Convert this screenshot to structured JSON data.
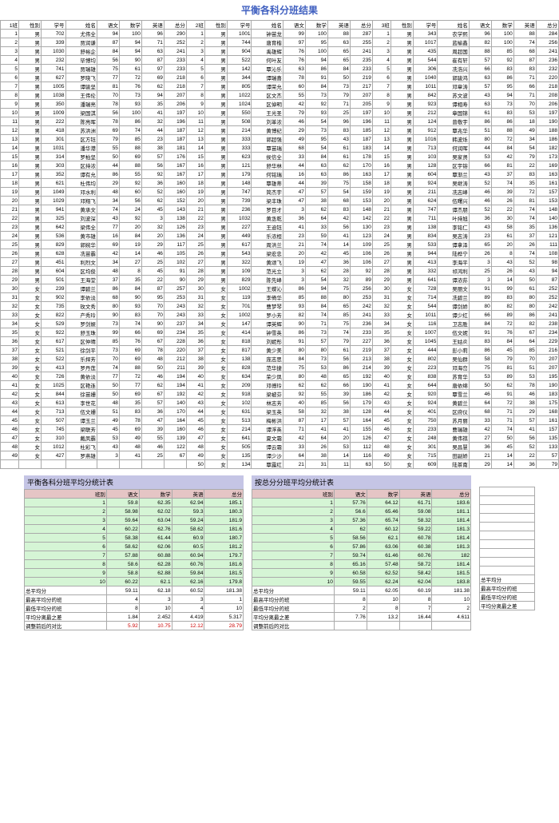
{
  "title": "平衡各科分班结果",
  "headers": [
    "班",
    "性别",
    "学号",
    "姓名",
    "语文",
    "数学",
    "英语",
    "总分"
  ],
  "class_labels": [
    "1班",
    "2班",
    "3班"
  ],
  "rows": [
    [
      1,
      "男",
      702,
      "尤伟全",
      94,
      100,
      96,
      290,
      1,
      "男",
      1001,
      "钟苗龙",
      99,
      100,
      88,
      287,
      1,
      "男",
      343,
      "农学熙",
      96,
      100,
      88,
      284
    ],
    [
      2,
      "男",
      339,
      "贾润谦",
      87,
      94,
      71,
      252,
      2,
      "男",
      744,
      "唐育楷",
      97,
      95,
      63,
      255,
      2,
      "男",
      1017,
      "蓝榆鑫",
      82,
      100,
      74,
      256
    ],
    [
      3,
      "男",
      1030,
      "舒裕企",
      84,
      94,
      63,
      241,
      3,
      "男",
      904,
      "禹雄辉",
      76,
      100,
      65,
      241,
      3,
      "男",
      435,
      "周超国",
      88,
      85,
      68,
      241
    ],
    [
      4,
      "男",
      232,
      "毕博均",
      56,
      90,
      87,
      233,
      4,
      "男",
      522,
      "何叶友",
      76,
      94,
      65,
      235,
      4,
      "男",
      544,
      "崔有轩",
      57,
      92,
      87,
      236
    ],
    [
      5,
      "男",
      741,
      "贾瑞雄",
      75,
      61,
      97,
      233,
      5,
      "男",
      142,
      "覃沁乐",
      63,
      86,
      84,
      233,
      5,
      "男",
      306,
      "冼浩兴",
      66,
      83,
      83,
      232
    ],
    [
      6,
      "男",
      627,
      "罗晓飞",
      77,
      72,
      69,
      218,
      6,
      "男",
      344,
      "谭瑞喜",
      78,
      91,
      50,
      219,
      6,
      "男",
      1040,
      "郭骏鸿",
      63,
      86,
      71,
      220
    ],
    [
      7,
      "男",
      1005,
      "谭骏坚",
      81,
      76,
      62,
      218,
      7,
      "男",
      805,
      "谭荣允",
      60,
      84,
      73,
      217,
      7,
      "男",
      1011,
      "邓章涛",
      57,
      95,
      66,
      218
    ],
    [
      8,
      "男",
      1038,
      "王伟伦",
      70,
      73,
      94,
      207,
      8,
      "男",
      1022,
      "区文杰",
      55,
      73,
      79,
      207,
      8,
      "男",
      842,
      "苏文波",
      43,
      94,
      71,
      208
    ],
    [
      9,
      "男",
      350,
      "潘瑞亮",
      78,
      93,
      35,
      206,
      9,
      "男",
      1024,
      "区倬明",
      42,
      92,
      71,
      205,
      9,
      "男",
      923,
      "谭相寿",
      63,
      73,
      70,
      206
    ],
    [
      10,
      "男",
      1009,
      "梁国淇",
      56,
      100,
      41,
      197,
      10,
      "男",
      550,
      "王光圣",
      79,
      93,
      25,
      197,
      10,
      "男",
      212,
      "章国锦",
      61,
      83,
      53,
      197
    ],
    [
      11,
      "男",
      222,
      "陈亮晖",
      78,
      86,
      32,
      196,
      11,
      "男",
      508,
      "刘革浓",
      46,
      54,
      96,
      196,
      11,
      "男",
      124,
      "曾敬宇",
      86,
      86,
      18,
      190
    ],
    [
      12,
      "男",
      418,
      "苏洪洲",
      69,
      74,
      44,
      187,
      12,
      "男",
      214,
      "黄博纪",
      29,
      73,
      83,
      185,
      12,
      "男",
      912,
      "覃兆华",
      51,
      88,
      49,
      188
    ],
    [
      13,
      "男",
      301,
      "区方钰",
      79,
      85,
      23,
      187,
      13,
      "男",
      333,
      "郭超强",
      49,
      95,
      43,
      187,
      13,
      "男",
      1016,
      "韩波烁",
      80,
      72,
      34,
      186
    ],
    [
      14,
      "男",
      1031,
      "潘华港",
      55,
      88,
      38,
      181,
      14,
      "男",
      333,
      "覃苗瑞",
      68,
      54,
      61,
      183,
      14,
      "男",
      713,
      "何润晖",
      44,
      84,
      54,
      182
    ],
    [
      15,
      "男",
      314,
      "罗柏坚",
      50,
      69,
      57,
      176,
      15,
      "男",
      623,
      "侯信全",
      33,
      84,
      61,
      178,
      15,
      "男",
      103,
      "吴家贤",
      53,
      42,
      79,
      173
    ],
    [
      16,
      "男",
      303,
      "区持浓",
      44,
      88,
      56,
      167,
      16,
      "男",
      121,
      "舒华林",
      44,
      63,
      62,
      170,
      16,
      "男",
      128,
      "区宇镕",
      66,
      81,
      22,
      169
    ],
    [
      17,
      "男",
      352,
      "谭有允",
      86,
      55,
      92,
      167,
      17,
      "男",
      179,
      "何铭瑞",
      16,
      63,
      86,
      163,
      17,
      "男",
      604,
      "覃渐兰",
      43,
      37,
      83,
      163
    ],
    [
      18,
      "男",
      621,
      "杜伟均",
      29,
      92,
      36,
      160,
      18,
      "男",
      148,
      "覃雄蒂",
      44,
      39,
      75,
      158,
      18,
      "男",
      924,
      "吴继涛",
      52,
      74,
      35,
      161
    ],
    [
      19,
      "男",
      1049,
      "邓水利",
      48,
      60,
      52,
      160,
      19,
      "男",
      747,
      "简杰宇",
      47,
      57,
      54,
      159,
      19,
      "男",
      211,
      "冼志峰",
      46,
      39,
      72,
      157
    ],
    [
      20,
      "男",
      1029,
      "邓翔飞",
      34,
      56,
      62,
      152,
      20,
      "男",
      739,
      "梁丰珠",
      47,
      38,
      68,
      153,
      20,
      "男",
      624,
      "伍曙兴",
      46,
      26,
      81,
      153
    ],
    [
      21,
      "男",
      941,
      "黄承文",
      74,
      24,
      45,
      143,
      21,
      "男",
      236,
      "罗目才",
      3,
      62,
      83,
      148,
      21,
      "男",
      747,
      "谭杰朋",
      52,
      22,
      74,
      148
    ],
    [
      22,
      "男",
      325,
      "刘波深",
      43,
      92,
      3,
      138,
      22,
      "男",
      1032,
      "黄丞乾",
      36,
      64,
      42,
      142,
      22,
      "男",
      711,
      "叶持旭",
      36,
      30,
      74,
      140
    ],
    [
      23,
      "男",
      642,
      "梁伟全",
      77,
      20,
      32,
      126,
      23,
      "男",
      227,
      "王迪钰",
      41,
      33,
      56,
      130,
      23,
      "男",
      138,
      "李铭仁",
      43,
      58,
      35,
      136
    ],
    [
      24,
      "男",
      536,
      "黄市雄",
      16,
      84,
      20,
      136,
      24,
      "男",
      449,
      "乐浓桓",
      23,
      59,
      41,
      123,
      24,
      "男",
      834,
      "吴志涛",
      23,
      61,
      37,
      121
    ],
    [
      25,
      "男",
      829,
      "郭婉华",
      69,
      19,
      29,
      117,
      25,
      "男",
      617,
      "周洪兰",
      21,
      74,
      14,
      109,
      25,
      "男",
      533,
      "谭拿泽",
      65,
      20,
      26,
      111
    ],
    [
      26,
      "男",
      628,
      "冼苗霸",
      42,
      14,
      46,
      105,
      26,
      "男",
      543,
      "梁宏忠",
      20,
      42,
      45,
      106,
      26,
      "男",
      944,
      "陆桦宁",
      26,
      8,
      74,
      108
    ],
    [
      27,
      "男",
      451,
      "利烈文",
      34,
      27,
      25,
      102,
      27,
      "男",
      322,
      "黄颂飞",
      19,
      47,
      36,
      106,
      27,
      "男",
      413,
      "李海平",
      3,
      43,
      52,
      98
    ],
    [
      28,
      "男",
      604,
      "区均俊",
      48,
      8,
      45,
      91,
      28,
      "男",
      109,
      "范光立",
      3,
      62,
      28,
      92,
      28,
      "男",
      332,
      "祁鸿利",
      25,
      26,
      43,
      94
    ],
    [
      29,
      "男",
      501,
      "王海堂",
      37,
      35,
      22,
      90,
      29,
      "男",
      829,
      "陈先峰",
      3,
      54,
      32,
      89,
      29,
      "男",
      641,
      "谭浓荪",
      3,
      14,
      50,
      87
    ],
    [
      30,
      "女",
      239,
      "谭碧兰",
      86,
      84,
      87,
      257,
      30,
      "女",
      1002,
      "王蝶沁",
      86,
      94,
      75,
      256,
      30,
      "女",
      728,
      "吴丽文",
      91,
      99,
      61,
      252
    ],
    [
      31,
      "女",
      902,
      "李依淡",
      68,
      90,
      95,
      253,
      31,
      "女",
      119,
      "李倚华",
      85,
      88,
      80,
      253,
      31,
      "女",
      714,
      "冼碧兰",
      89,
      83,
      80,
      252
    ],
    [
      32,
      "女",
      735,
      "玫文秀",
      80,
      93,
      70,
      243,
      32,
      "女",
      701,
      "曹梦琴",
      93,
      84,
      65,
      242,
      32,
      "女",
      544,
      "谭剑娇",
      80,
      82,
      80,
      242
    ],
    [
      33,
      "女",
      822,
      "产秀玲",
      90,
      83,
      70,
      243,
      33,
      "女",
      1002,
      "罗小芳",
      82,
      74,
      85,
      241,
      33,
      "女",
      1011,
      "谭少红",
      66,
      89,
      86,
      241
    ],
    [
      34,
      "女",
      529,
      "罗剑娱",
      73,
      74,
      90,
      237,
      34,
      "女",
      147,
      "谭英辉",
      90,
      71,
      75,
      236,
      34,
      "女",
      116,
      "卫志胜",
      84,
      72,
      82,
      238
    ],
    [
      35,
      "女",
      922,
      "舒玉珠",
      99,
      66,
      69,
      234,
      35,
      "女",
      414,
      "钟雪英",
      86,
      73,
      74,
      233,
      35,
      "女",
      1007,
      "伍文妮",
      91,
      76,
      67,
      234
    ],
    [
      36,
      "女",
      617,
      "区仲晴",
      85,
      76,
      67,
      228,
      36,
      "女",
      818,
      "刘妮彤",
      91,
      57,
      79,
      227,
      36,
      "女",
      1045,
      "王姑炎",
      83,
      84,
      64,
      229
    ],
    [
      37,
      "女",
      521,
      "徐剑平",
      73,
      69,
      78,
      220,
      37,
      "女",
      817,
      "黄少美",
      80,
      80,
      61,
      219,
      37,
      "女",
      444,
      "彭小莉",
      86,
      45,
      85,
      216
    ],
    [
      38,
      "女",
      522,
      "乐捍芳",
      70,
      69,
      48,
      212,
      38,
      "女",
      138,
      "庞志思",
      84,
      73,
      56,
      213,
      38,
      "女",
      802,
      "吴仙群",
      58,
      79,
      70,
      207
    ],
    [
      39,
      "女",
      413,
      "罗丹莲",
      74,
      88,
      50,
      211,
      39,
      "女",
      828,
      "范华捷",
      75,
      53,
      86,
      214,
      39,
      "女",
      223,
      "邓海峦",
      75,
      81,
      51,
      207
    ],
    [
      40,
      "女",
      726,
      "黄依淡",
      77,
      72,
      46,
      194,
      40,
      "女",
      634,
      "荣少凤",
      80,
      48,
      65,
      192,
      40,
      "女",
      838,
      "苏育华",
      53,
      89,
      53,
      195
    ],
    [
      41,
      "女",
      1025,
      "区艳连",
      50,
      77,
      62,
      194,
      41,
      "女",
      209,
      "邓傅玲",
      62,
      62,
      66,
      190,
      41,
      "女",
      644,
      "唐依绵",
      50,
      62,
      78,
      190
    ],
    [
      42,
      "女",
      844,
      "徐苗姗",
      50,
      69,
      67,
      192,
      42,
      "女",
      918,
      "梁被芬",
      92,
      55,
      39,
      186,
      42,
      "女",
      920,
      "覃雪兰",
      46,
      91,
      46,
      183
    ],
    [
      43,
      "女",
      613,
      "李世花",
      48,
      35,
      57,
      140,
      43,
      "女",
      102,
      "林志芳",
      40,
      85,
      56,
      179,
      43,
      "女",
      924,
      "黄碧兰",
      64,
      72,
      38,
      175
    ],
    [
      44,
      "女",
      713,
      "伍文姗",
      51,
      83,
      36,
      170,
      44,
      "女",
      631,
      "梁玉英",
      58,
      32,
      38,
      128,
      44,
      "女",
      401,
      "区府仪",
      68,
      71,
      29,
      168
    ],
    [
      45,
      "女",
      507,
      "谭玉兰",
      49,
      78,
      47,
      164,
      45,
      "女",
      513,
      "梅彬洪",
      87,
      17,
      57,
      164,
      45,
      "女",
      750,
      "苏月丽",
      33,
      71,
      57,
      161
    ],
    [
      46,
      "女",
      745,
      "梁联芳",
      45,
      69,
      39,
      160,
      46,
      "女",
      214,
      "谭浮英",
      71,
      41,
      41,
      155,
      46,
      "女",
      233,
      "曹瑞雄",
      42,
      74,
      41,
      157
    ],
    [
      47,
      "女",
      310,
      "戴凤霸",
      53,
      49,
      55,
      139,
      47,
      "女",
      641,
      "夏文霜",
      42,
      64,
      20,
      126,
      47,
      "女",
      248,
      "黄伟祺",
      27,
      50,
      56,
      135
    ],
    [
      48,
      "女",
      1012,
      "杜彩飞",
      43,
      48,
      46,
      122,
      48,
      "女",
      505,
      "谭云霜",
      33,
      26,
      53,
      112,
      48,
      "女",
      301,
      "吴昌慧",
      36,
      45,
      52,
      133
    ],
    [
      49,
      "女",
      427,
      "罗燕雄",
      3,
      41,
      25,
      67,
      49,
      "女",
      135,
      "谭少沙",
      64,
      38,
      14,
      116,
      49,
      "女",
      715,
      "田副娇",
      21,
      14,
      22,
      57
    ],
    [
      "",
      "",
      "",
      "",
      "",
      "",
      "",
      "",
      50,
      "女",
      134,
      "覃露红",
      21,
      31,
      11,
      63,
      50,
      "女",
      609,
      "陆茶南",
      29,
      14,
      36,
      79
    ]
  ],
  "summary1_title": "平衡各科分班平均分统计表",
  "summary2_title": "按总分分班平均分统计表",
  "sum_head": [
    "班别",
    "语文",
    "数学",
    "英语",
    "总分"
  ],
  "sum1": [
    [
      1,
      59.8,
      62.35,
      62.94,
      185.1
    ],
    [
      2,
      58.98,
      62.02,
      59.3,
      180.3
    ],
    [
      3,
      59.64,
      63.04,
      59.24,
      181.9
    ],
    [
      4,
      60.22,
      62.76,
      58.62,
      181.6
    ],
    [
      5,
      58.38,
      61.44,
      60.9,
      180.7
    ],
    [
      6,
      58.62,
      62.06,
      60.5,
      181.2
    ],
    [
      7,
      57.88,
      60.88,
      60.94,
      179.7
    ],
    [
      8,
      58.6,
      62.28,
      60.76,
      181.6
    ],
    [
      9,
      58.8,
      62.88,
      59.84,
      181.5
    ],
    [
      10,
      60.22,
      62.1,
      62.16,
      179.8
    ]
  ],
  "sum2": [
    [
      1,
      57.76,
      64.12,
      61.71,
      183.6
    ],
    [
      2,
      56.6,
      65.46,
      59.08,
      181.1
    ],
    [
      3,
      57.36,
      65.74,
      58.32,
      181.4
    ],
    [
      4,
      62,
      60.12,
      59.22,
      181.3
    ],
    [
      5,
      58.56,
      62.1,
      60.78,
      181.4
    ],
    [
      6,
      57.86,
      63.06,
      60.38,
      181.3
    ],
    [
      7,
      59.74,
      61.46,
      60.76,
      182
    ],
    [
      8,
      65.16,
      57.48,
      58.72,
      181.4
    ],
    [
      9,
      60.58,
      62.52,
      58.42,
      181.5
    ],
    [
      10,
      59.55,
      62.24,
      62.04,
      183.8
    ]
  ],
  "avg_label": "总平均分",
  "avg1": [
    59.11,
    62.18,
    60.52,
    181.38
  ],
  "avg2": [
    59.11,
    62.05,
    60.19,
    181.38
  ],
  "stat_labels": [
    "最高平均分的班",
    "最低平均分的班",
    "平均分离最之差",
    "调整前后的对比"
  ],
  "stat1": [
    [
      4,
      3,
      3,
      1
    ],
    [
      8,
      10,
      4,
      10
    ],
    [
      1.84,
      2.452,
      4.419,
      5.317
    ],
    [
      5.92,
      10.75,
      12.12,
      28.79
    ]
  ],
  "stat2": [
    [
      8,
      10,
      8,
      10
    ],
    [
      2,
      8,
      7,
      2
    ],
    [
      7.76,
      13.2,
      16.44,
      4.611
    ],
    [
      "",
      "",
      "",
      ""
    ]
  ],
  "right_labels": [
    "总平均分",
    "最高平均分的班",
    "最低平均分的班",
    "平均分离最之差"
  ]
}
